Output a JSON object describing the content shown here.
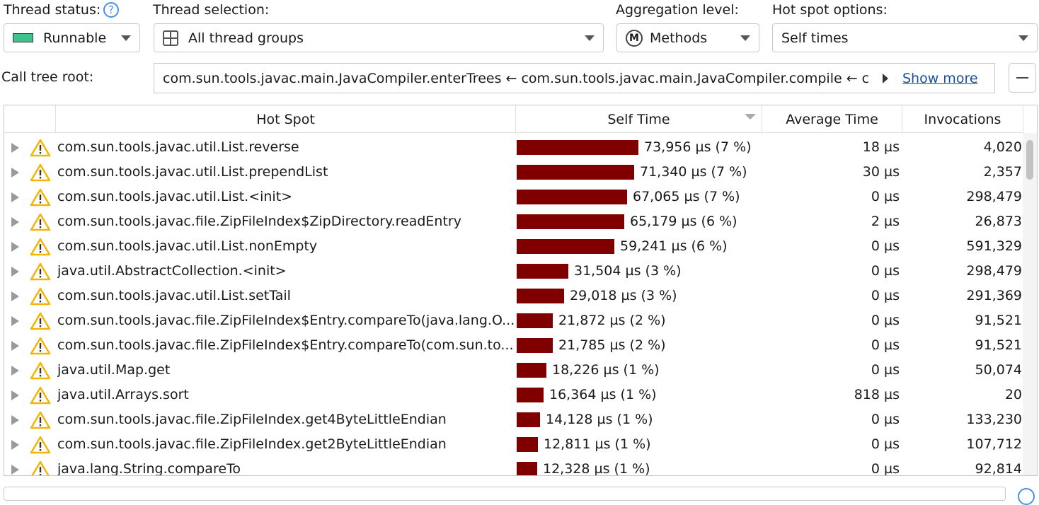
{
  "filters": {
    "thread_status_label": "Thread status:",
    "thread_status_value": "Runnable",
    "thread_status_color": "#3cc48a",
    "thread_selection_label": "Thread selection:",
    "thread_selection_value": "All thread groups",
    "aggregation_label": "Aggregation level:",
    "aggregation_value": "Methods",
    "hotspot_options_label": "Hot spot options:",
    "hotspot_options_value": "Self times",
    "call_tree_root_label": "Call tree root:",
    "call_tree_root_value": "com.sun.tools.javac.main.JavaCompiler.enterTrees ← com.sun.tools.javac.main.JavaCompiler.compile ← c",
    "show_more": "Show more",
    "help_icon": "?",
    "methods_icon": "M"
  },
  "table": {
    "columns": [
      "Hot Spot",
      "Self Time",
      "Average Time",
      "Invocations"
    ],
    "bar_color": "#800000",
    "max_self_time_us": 73956,
    "rows": [
      {
        "name": "com.sun.tools.javac.util.List.reverse",
        "self_us": 73956,
        "self": "73,956 µs (7 %)",
        "avg": "18 µs",
        "inv": "4,020"
      },
      {
        "name": "com.sun.tools.javac.util.List.prependList",
        "self_us": 71340,
        "self": "71,340 µs (7 %)",
        "avg": "30 µs",
        "inv": "2,357"
      },
      {
        "name": "com.sun.tools.javac.util.List.<init>",
        "self_us": 67065,
        "self": "67,065 µs (7 %)",
        "avg": "0 µs",
        "inv": "298,479"
      },
      {
        "name": "com.sun.tools.javac.file.ZipFileIndex$ZipDirectory.readEntry",
        "self_us": 65179,
        "self": "65,179 µs (6 %)",
        "avg": "2 µs",
        "inv": "26,873"
      },
      {
        "name": "com.sun.tools.javac.util.List.nonEmpty",
        "self_us": 59241,
        "self": "59,241 µs (6 %)",
        "avg": "0 µs",
        "inv": "591,329"
      },
      {
        "name": "java.util.AbstractCollection.<init>",
        "self_us": 31504,
        "self": "31,504 µs (3 %)",
        "avg": "0 µs",
        "inv": "298,479"
      },
      {
        "name": "com.sun.tools.javac.util.List.setTail",
        "self_us": 29018,
        "self": "29,018 µs (3 %)",
        "avg": "0 µs",
        "inv": "291,369"
      },
      {
        "name": "com.sun.tools.javac.file.ZipFileIndex$Entry.compareTo(java.lang.O...",
        "self_us": 21872,
        "self": "21,872 µs (2 %)",
        "avg": "0 µs",
        "inv": "91,521"
      },
      {
        "name": "com.sun.tools.javac.file.ZipFileIndex$Entry.compareTo(com.sun.to...",
        "self_us": 21785,
        "self": "21,785 µs (2 %)",
        "avg": "0 µs",
        "inv": "91,521"
      },
      {
        "name": "java.util.Map.get",
        "self_us": 18226,
        "self": "18,226 µs (1 %)",
        "avg": "0 µs",
        "inv": "50,074"
      },
      {
        "name": "java.util.Arrays.sort",
        "self_us": 16364,
        "self": "16,364 µs (1 %)",
        "avg": "818 µs",
        "inv": "20"
      },
      {
        "name": "com.sun.tools.javac.file.ZipFileIndex.get4ByteLittleEndian",
        "self_us": 14128,
        "self": "14,128 µs (1 %)",
        "avg": "0 µs",
        "inv": "133,230"
      },
      {
        "name": "com.sun.tools.javac.file.ZipFileIndex.get2ByteLittleEndian",
        "self_us": 12811,
        "self": "12,811 µs (1 %)",
        "avg": "0 µs",
        "inv": "107,712"
      },
      {
        "name": "java.lang.String.compareTo",
        "self_us": 12328,
        "self": "12,328 µs (1 %)",
        "avg": "0 µs",
        "inv": "92,814"
      }
    ]
  }
}
